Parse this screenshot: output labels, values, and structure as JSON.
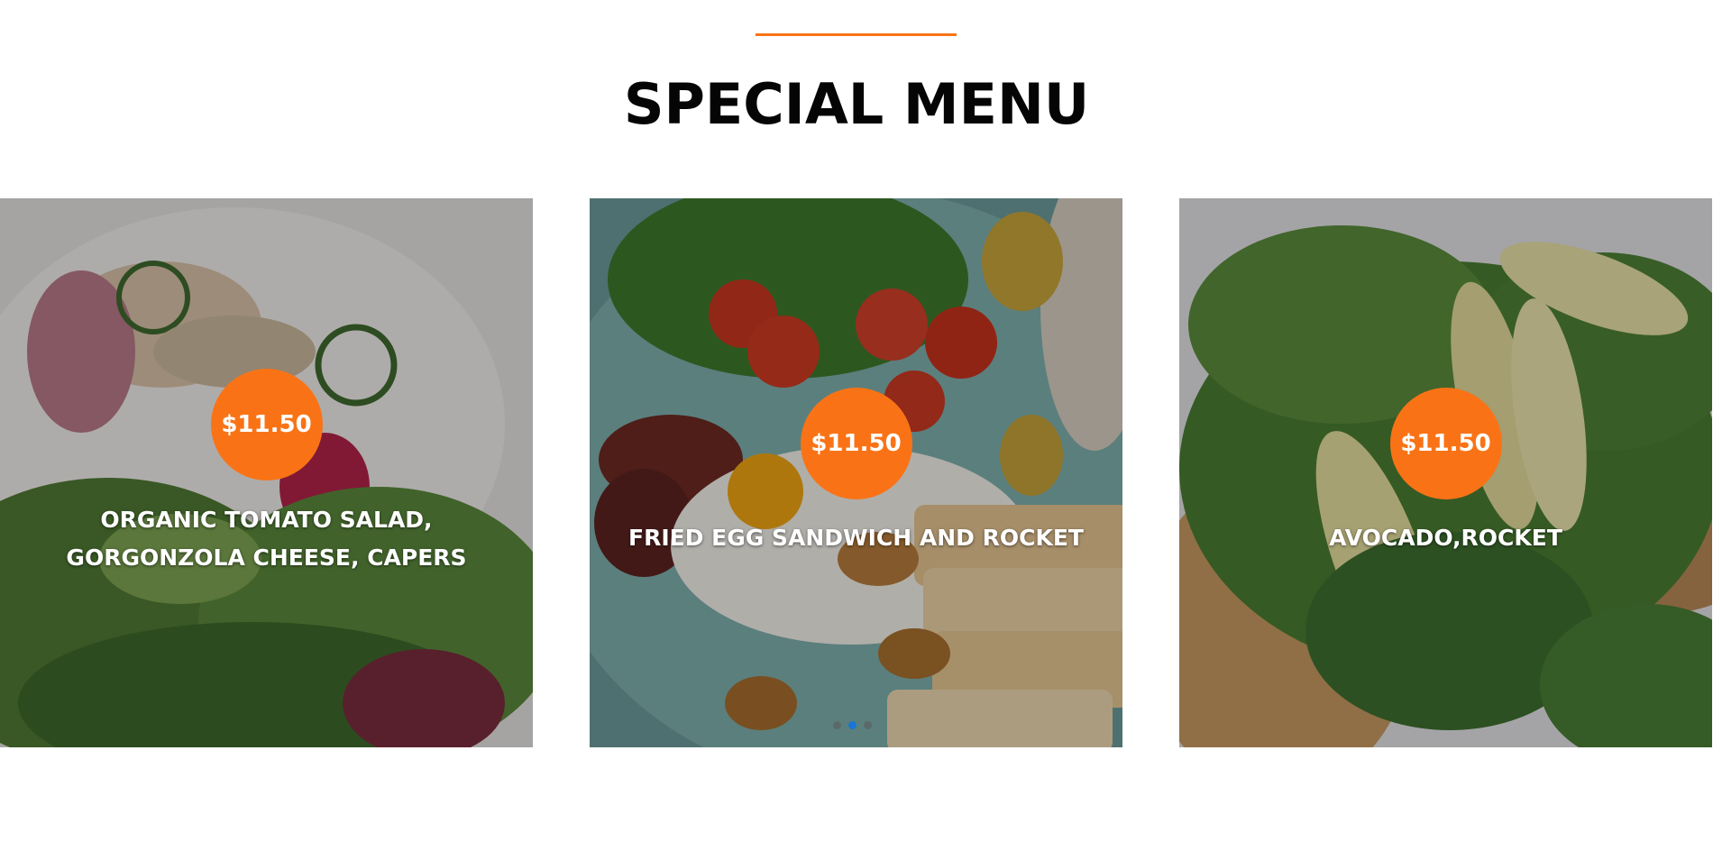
{
  "section": {
    "title": "SPECIAL MENU",
    "accent_color": "#f97316"
  },
  "menu_items": [
    {
      "price": "$11.50",
      "name": "ORGANIC TOMATO SALAD,\nGORGONZOLA CHEESE, CAPERS",
      "image": "salad-photo"
    },
    {
      "price": "$11.50",
      "name": "FRIED EGG SANDWICH AND ROCKET",
      "image": "fried-egg-breakfast-photo"
    },
    {
      "price": "$11.50",
      "name": "AVOCADO,ROCKET",
      "image": "avocado-toast-photo"
    }
  ],
  "carousel": {
    "dot_count": 3,
    "active_index": 1,
    "active_color": "#1976d2"
  }
}
